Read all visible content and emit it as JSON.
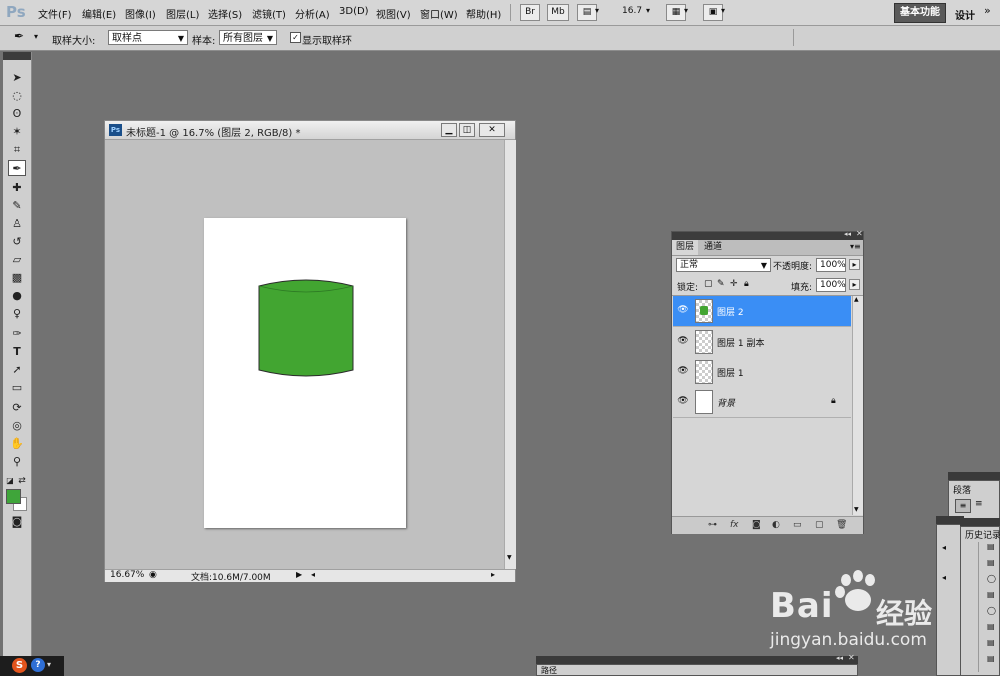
{
  "app": {
    "logo": "Ps"
  },
  "menu": [
    "文件(F)",
    "编辑(E)",
    "图像(I)",
    "图层(L)",
    "选择(S)",
    "滤镜(T)",
    "分析(A)",
    "3D(D)",
    "视图(V)",
    "窗口(W)",
    "帮助(H)"
  ],
  "appbar": {
    "bridge": "Br",
    "minibridge": "Mb",
    "zoom": "16.7",
    "workspace_active": "基本功能",
    "workspace_other": "设计",
    "more": "»"
  },
  "options": {
    "sample_size_label": "取样大小:",
    "sample_size_value": "取样点",
    "sample_label": "样本:",
    "sample_value": "所有图层",
    "show_ring_checked": "✓",
    "show_ring_label": "显示取样环"
  },
  "document": {
    "ps_icon": "Ps",
    "title": "未标题-1 @ 16.7% (图层 2, RGB/8) *",
    "zoom": "16.67%",
    "doc_info": "文档:10.6M/7.00M",
    "shape_color": "#42a531"
  },
  "layers_panel": {
    "tabs": [
      "图层",
      "通道"
    ],
    "blend_mode": "正常",
    "opacity_label": "不透明度:",
    "opacity_value": "100%",
    "lock_label": "锁定:",
    "fill_label": "填充:",
    "fill_value": "100%",
    "layers": [
      {
        "name": "图层 2",
        "selected": true
      },
      {
        "name": "图层 1 副本",
        "selected": false
      },
      {
        "name": "图层 1",
        "selected": false
      },
      {
        "name": "背景",
        "selected": false,
        "locked": true
      }
    ]
  },
  "side_panels": {
    "paragraph_tab": "段落",
    "history_tab": "历史记录",
    "paths_tab": "路径"
  },
  "colors": {
    "foreground": "#3fa53a",
    "background": "#ffffff",
    "selection": "#3a8ef5"
  },
  "watermark": {
    "brand": "Bai",
    "brand2": "经验",
    "url": "jingyan.baidu.com"
  }
}
